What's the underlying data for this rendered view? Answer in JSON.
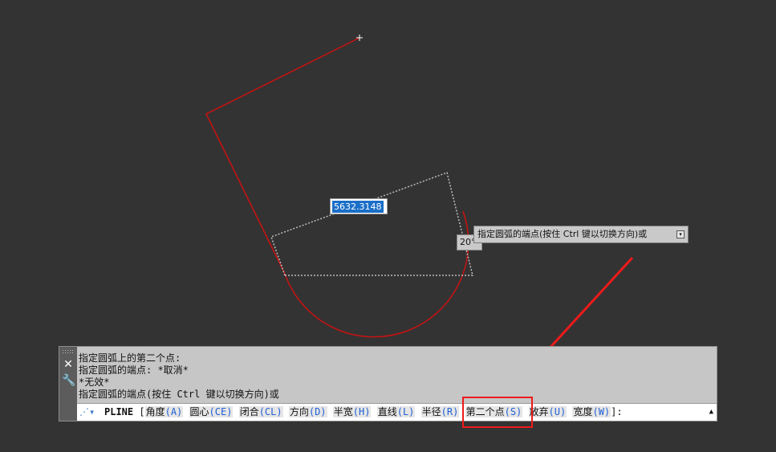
{
  "canvas": {
    "background": "#333333",
    "polyline_color": "#cc1111",
    "preview_color": "#bdbdbd",
    "dynamic_distance": "5632.3148",
    "dynamic_angle": "20°",
    "prompt_tooltip": "指定圆弧的端点(按住 Ctrl 键以切换方向)或",
    "tooltip_button_icon": "expand-down-icon"
  },
  "command_panel": {
    "side_icons": [
      "close-icon",
      "wrench-icon"
    ],
    "history": [
      "指定圆弧上的第二个点:",
      "指定圆弧的端点: *取消*",
      "*无效*",
      "指定圆弧的端点(按住 Ctrl 键以切换方向)或"
    ],
    "command_icon": "command-prompt-icon",
    "command_name": "PLINE",
    "open_bracket": "[",
    "close_bracket": "]:",
    "options": [
      {
        "label": "角度",
        "key": "(A)"
      },
      {
        "label": "圆心",
        "key": "(CE)"
      },
      {
        "label": "闭合",
        "key": "(CL)"
      },
      {
        "label": "方向",
        "key": "(D)"
      },
      {
        "label": "半宽",
        "key": "(H)"
      },
      {
        "label": "直线",
        "key": "(L)"
      },
      {
        "label": "半径",
        "key": "(R)"
      },
      {
        "label": "第二个点",
        "key": "(S)"
      },
      {
        "label": "放弃",
        "key": "(U)"
      },
      {
        "label": "宽度",
        "key": "(W)"
      }
    ],
    "scroll_icon": "scroll-up-icon"
  },
  "annotation": {
    "color": "#ee1a1a",
    "highlighted_option": "第二个点(S)"
  }
}
